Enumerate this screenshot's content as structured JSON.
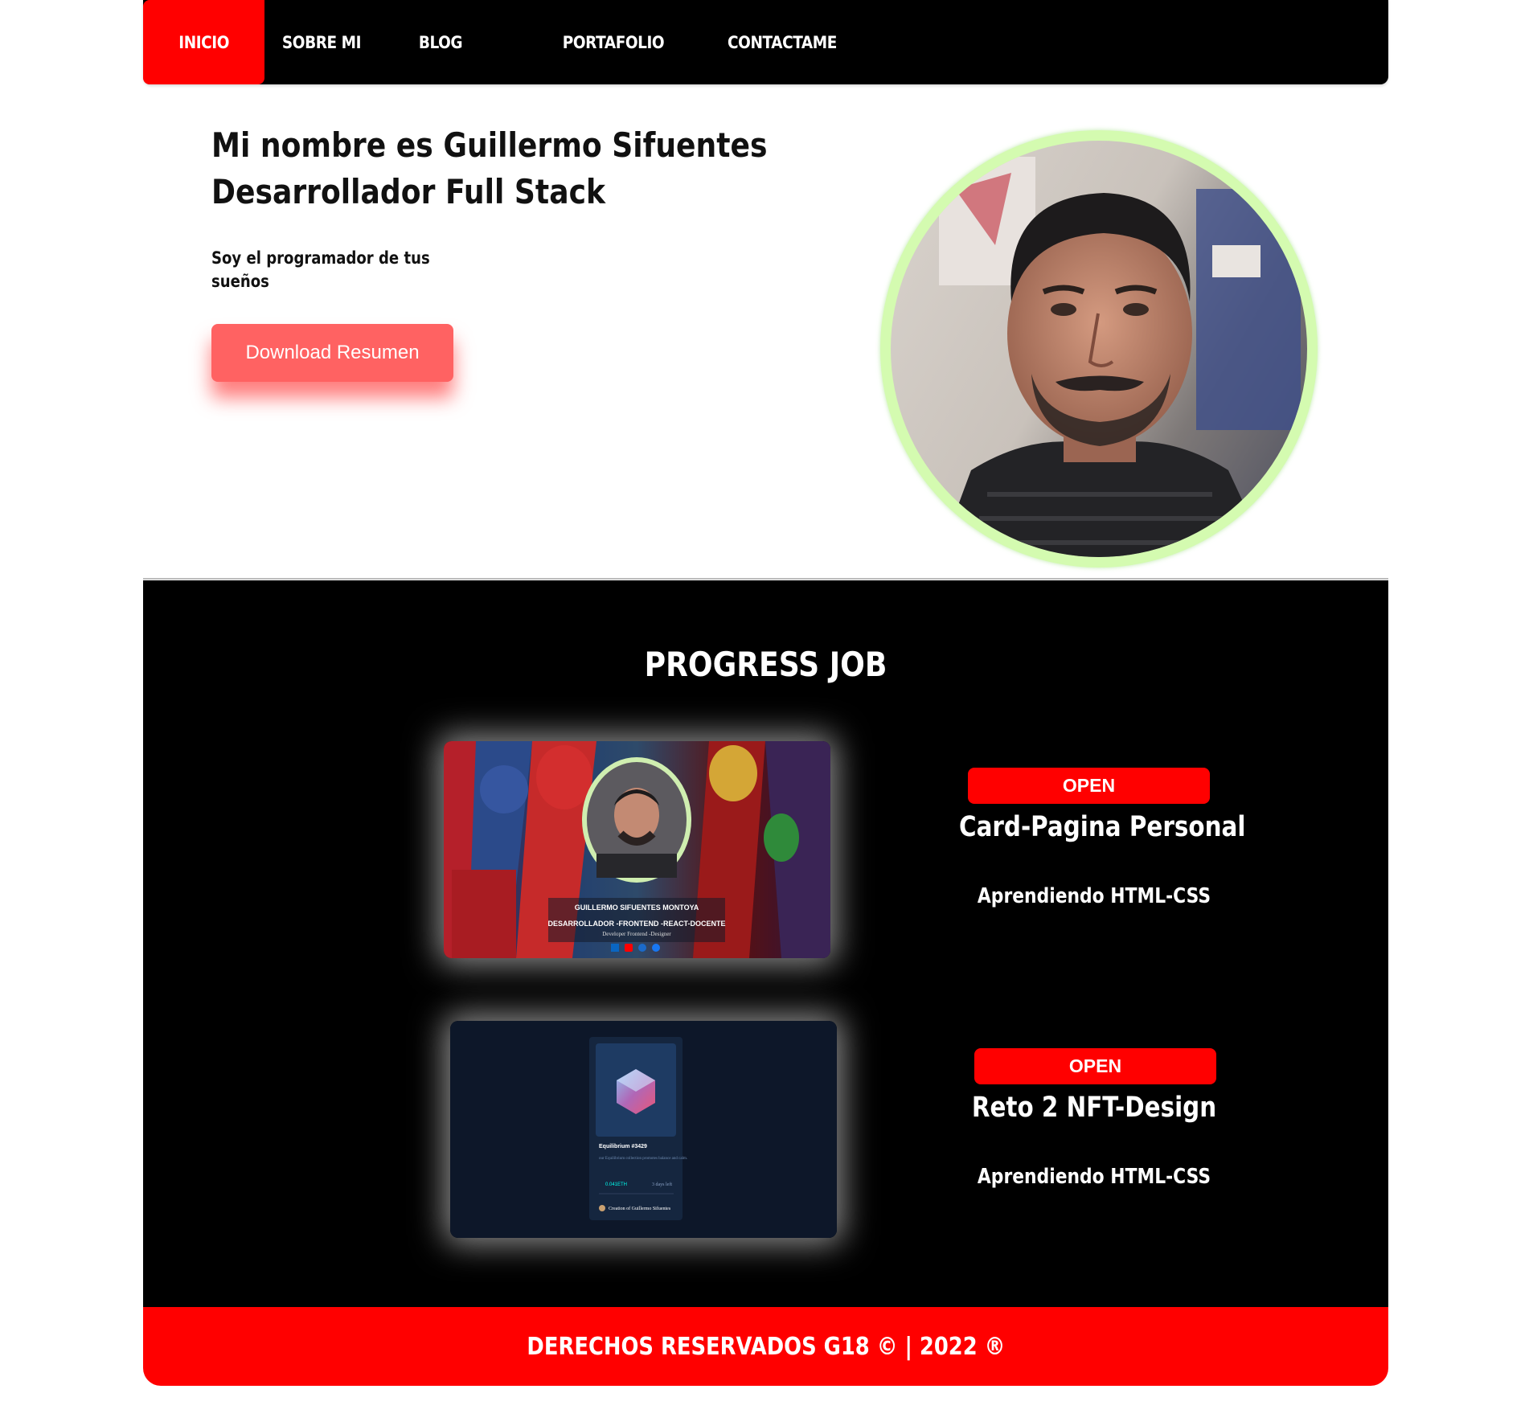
{
  "nav": {
    "items": [
      {
        "label": "INICIO",
        "active": true
      },
      {
        "label": "SOBRE MI",
        "active": false
      },
      {
        "label": "BLOG",
        "active": false
      },
      {
        "label": "PORTAFOLIO",
        "active": false
      },
      {
        "label": "CONTACTAME",
        "active": false
      }
    ]
  },
  "hero": {
    "title_line1": "Mi nombre es Guillermo Sifuentes",
    "title_line2": "Desarrollador Full Stack",
    "subtitle": "Soy el programador de tus sueños",
    "download_label": "Download Resumen"
  },
  "progress": {
    "title": "PROGRESS JOB",
    "projects": [
      {
        "badge": "OPEN",
        "name": "Card-Pagina Personal",
        "description": "Aprendiendo HTML-CSS",
        "thumb": {
          "person_name": "GUILLERMO SIFUENTES MONTOYA",
          "tagline": "DESARROLLADOR -FRONTEND -REACT-DOCENTE",
          "subtag": "Developer Frontend -Designer"
        }
      },
      {
        "badge": "OPEN",
        "name": "Reto 2 NFT-Design",
        "description": "Aprendiendo HTML-CSS",
        "thumb": {
          "nft_title": "Equilibrium #3429",
          "nft_desc": "our Equilibrium collection promotes balance and calm.",
          "price": "0.041ETH",
          "time": "3 days left",
          "creator": "Creation of Guillermo Sifuentes"
        }
      }
    ]
  },
  "footer": {
    "text": "DERECHOS RESERVADOS G18 © | 2022 ®"
  },
  "colors": {
    "accent": "#ff0000",
    "button": "#ff6262",
    "avatar_ring": "#d4fbb0",
    "section_bg": "#000000"
  }
}
